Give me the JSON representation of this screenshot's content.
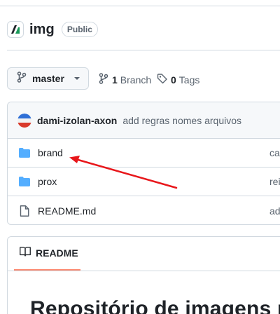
{
  "repo": {
    "name": "img",
    "visibility": "Public",
    "logo_icon": "repo-owner-logo-icon"
  },
  "branch": {
    "current": "master",
    "icon": "git-branch-icon"
  },
  "meta": {
    "branches_count": "1",
    "branches_label": "Branch",
    "tags_count": "0",
    "tags_label": "Tags"
  },
  "last_commit": {
    "author": "dami-izolan-axon",
    "message": "add regras nomes arquivos"
  },
  "files": [
    {
      "name": "brand",
      "type": "folder",
      "commit_message": "ca"
    },
    {
      "name": "prox",
      "type": "folder",
      "commit_message": "rei"
    },
    {
      "name": "README.md",
      "type": "file",
      "commit_message": "ad"
    }
  ],
  "readme": {
    "tab_label": "README",
    "heading": "Repositório de imagens p"
  },
  "colors": {
    "folder": "#54aeff",
    "accent_underline": "#fd8c73",
    "annotation_arrow": "#e8171b"
  }
}
